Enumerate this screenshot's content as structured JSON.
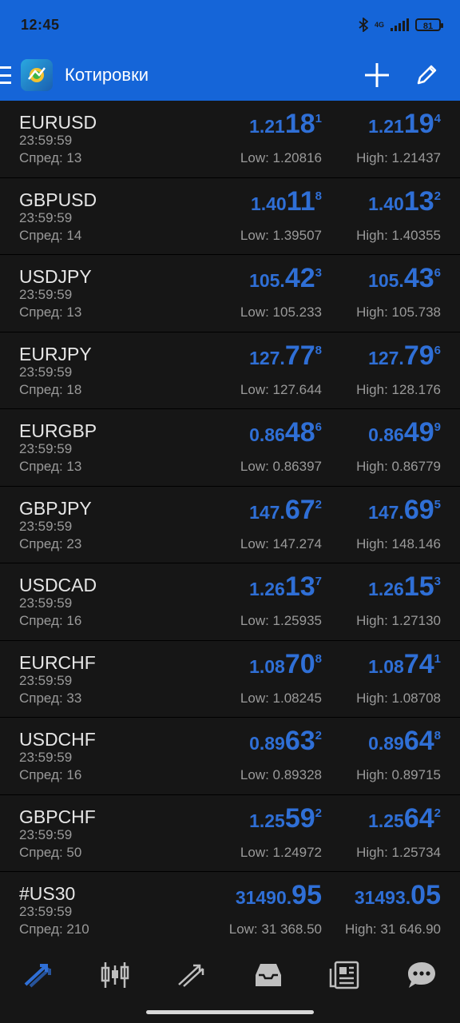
{
  "status": {
    "time": "12:45",
    "battery": "81",
    "network": "4G"
  },
  "app": {
    "title": "Котировки"
  },
  "quotes": [
    {
      "symbol": "EURUSD",
      "time": "23:59:59",
      "spread": "Спред: 13",
      "bid_pre": "1.21",
      "bid_big": "18",
      "bid_sup": "1",
      "ask_pre": "1.21",
      "ask_big": "19",
      "ask_sup": "4",
      "low": "Low: 1.20816",
      "high": "High: 1.21437"
    },
    {
      "symbol": "GBPUSD",
      "time": "23:59:59",
      "spread": "Спред: 14",
      "bid_pre": "1.40",
      "bid_big": "11",
      "bid_sup": "8",
      "ask_pre": "1.40",
      "ask_big": "13",
      "ask_sup": "2",
      "low": "Low: 1.39507",
      "high": "High: 1.40355"
    },
    {
      "symbol": "USDJPY",
      "time": "23:59:59",
      "spread": "Спред: 13",
      "bid_pre": "105.",
      "bid_big": "42",
      "bid_sup": "3",
      "ask_pre": "105.",
      "ask_big": "43",
      "ask_sup": "6",
      "low": "Low: 105.233",
      "high": "High: 105.738"
    },
    {
      "symbol": "EURJPY",
      "time": "23:59:59",
      "spread": "Спред: 18",
      "bid_pre": "127.",
      "bid_big": "77",
      "bid_sup": "8",
      "ask_pre": "127.",
      "ask_big": "79",
      "ask_sup": "6",
      "low": "Low: 127.644",
      "high": "High: 128.176"
    },
    {
      "symbol": "EURGBP",
      "time": "23:59:59",
      "spread": "Спред: 13",
      "bid_pre": "0.86",
      "bid_big": "48",
      "bid_sup": "6",
      "ask_pre": "0.86",
      "ask_big": "49",
      "ask_sup": "9",
      "low": "Low: 0.86397",
      "high": "High: 0.86779"
    },
    {
      "symbol": "GBPJPY",
      "time": "23:59:59",
      "spread": "Спред: 23",
      "bid_pre": "147.",
      "bid_big": "67",
      "bid_sup": "2",
      "ask_pre": "147.",
      "ask_big": "69",
      "ask_sup": "5",
      "low": "Low: 147.274",
      "high": "High: 148.146"
    },
    {
      "symbol": "USDCAD",
      "time": "23:59:59",
      "spread": "Спред: 16",
      "bid_pre": "1.26",
      "bid_big": "13",
      "bid_sup": "7",
      "ask_pre": "1.26",
      "ask_big": "15",
      "ask_sup": "3",
      "low": "Low: 1.25935",
      "high": "High: 1.27130"
    },
    {
      "symbol": "EURCHF",
      "time": "23:59:59",
      "spread": "Спред: 33",
      "bid_pre": "1.08",
      "bid_big": "70",
      "bid_sup": "8",
      "ask_pre": "1.08",
      "ask_big": "74",
      "ask_sup": "1",
      "low": "Low: 1.08245",
      "high": "High: 1.08708"
    },
    {
      "symbol": "USDCHF",
      "time": "23:59:59",
      "spread": "Спред: 16",
      "bid_pre": "0.89",
      "bid_big": "63",
      "bid_sup": "2",
      "ask_pre": "0.89",
      "ask_big": "64",
      "ask_sup": "8",
      "low": "Low: 0.89328",
      "high": "High: 0.89715"
    },
    {
      "symbol": "GBPCHF",
      "time": "23:59:59",
      "spread": "Спред: 50",
      "bid_pre": "1.25",
      "bid_big": "59",
      "bid_sup": "2",
      "ask_pre": "1.25",
      "ask_big": "64",
      "ask_sup": "2",
      "low": "Low: 1.24972",
      "high": "High: 1.25734"
    },
    {
      "symbol": "#US30",
      "time": "23:59:59",
      "spread": "Спред: 210",
      "bid_pre": "31490.",
      "bid_big": "95",
      "bid_sup": "",
      "ask_pre": "31493.",
      "ask_big": "05",
      "ask_sup": "",
      "low": "Low: 31 368.50",
      "high": "High: 31 646.90"
    }
  ],
  "nav": [
    "quotes-icon",
    "chart-icon",
    "trade-icon",
    "history-icon",
    "news-icon",
    "chat-icon"
  ],
  "colors": {
    "accent": "#1565d8",
    "price": "#2f6fd6",
    "rowbg": "#161616"
  }
}
